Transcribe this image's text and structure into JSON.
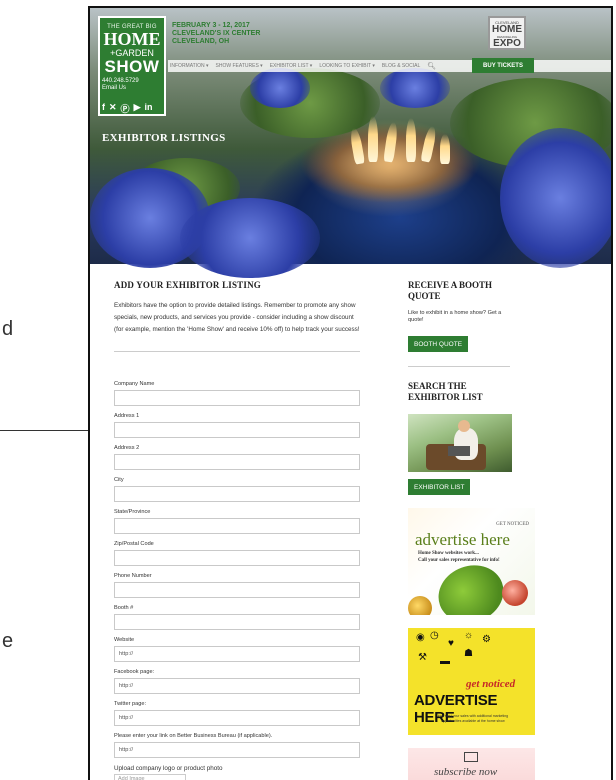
{
  "edge": {
    "left_chars": [
      "d",
      "e"
    ]
  },
  "header": {
    "logo": {
      "line1": "THE GREAT BIG",
      "line2": "HOME",
      "line3": "+GARDEN",
      "line4": "SHOW"
    },
    "phone": "440.248.5729",
    "email_link": "Email Us",
    "social_icons": [
      "facebook-icon",
      "twitter-icon",
      "pinterest-icon",
      "youtube-icon",
      "linkedin-icon"
    ],
    "social_glyphs": [
      "f",
      "✕",
      "Ⓟ",
      "▶",
      "in"
    ],
    "event": {
      "dates": "FEBRUARY 3 - 12, 2017",
      "venue": "CLEVELAND'S IX CENTER",
      "city": "CLEVELAND, OH"
    },
    "expo_logo": {
      "line1": "CLEVELAND",
      "line2": "HOME",
      "line3": "REMODELING",
      "line4": "EXPO"
    },
    "nav": [
      "INFORMATION ▾",
      "SHOW FEATURES ▾",
      "EXHIBITOR LIST ▾",
      "LOOKING TO EXHIBIT ▾",
      "BLOG & SOCIAL"
    ],
    "buy_tickets": "BUY TICKETS",
    "hero_title": "EXHIBITOR LISTINGS",
    "colors": {
      "brand_green": "#2e7d32"
    }
  },
  "main": {
    "heading": "ADD YOUR EXHIBITOR LISTING",
    "intro": "Exhibitors have the option to provide detailed listings. Remember to promote any show specials, new products, and services you provide - consider including a show discount (for example, mention the 'Home Show' and receive 10% off) to help track your success!",
    "fields": [
      {
        "label": "Company Name",
        "value": ""
      },
      {
        "label": "Address 1",
        "value": ""
      },
      {
        "label": "Address 2",
        "value": ""
      },
      {
        "label": "City",
        "value": ""
      },
      {
        "label": "State/Province",
        "value": ""
      },
      {
        "label": "Zip/Postal Code",
        "value": ""
      },
      {
        "label": "Phone Number",
        "value": ""
      },
      {
        "label": "Booth #",
        "value": ""
      },
      {
        "label": "Website",
        "value": "http://"
      },
      {
        "label": "Facebook page:",
        "value": "http://"
      },
      {
        "label": "Twitter page:",
        "value": "http://"
      },
      {
        "label": "Please enter your link on Better Business Bureau (if applicable).",
        "value": "http://"
      }
    ],
    "upload_label": "Upload company logo or product photo",
    "upload_button": "Add Image"
  },
  "sidebar": {
    "quote_heading": "RECEIVE A BOOTH QUOTE",
    "quote_text": "Like to exhibit in a home show? Get a quote!",
    "quote_button": "BOOTH QUOTE",
    "search_heading": "SEARCH THE EXHIBITOR LIST",
    "exhibitor_button": "EXHIBITOR LIST",
    "ad1": {
      "tag": "GET NOTICED",
      "headline": "advertise here",
      "line1": "Home Show websites work...",
      "line2": "Call your sales representative for info!"
    },
    "ad2": {
      "tag": "get noticed",
      "headline": "ADVERTISE HERE",
      "sub": "kick start your sales with additional marketing opportunities available at the home show"
    },
    "ad3": {
      "headline": "subscribe now"
    }
  }
}
